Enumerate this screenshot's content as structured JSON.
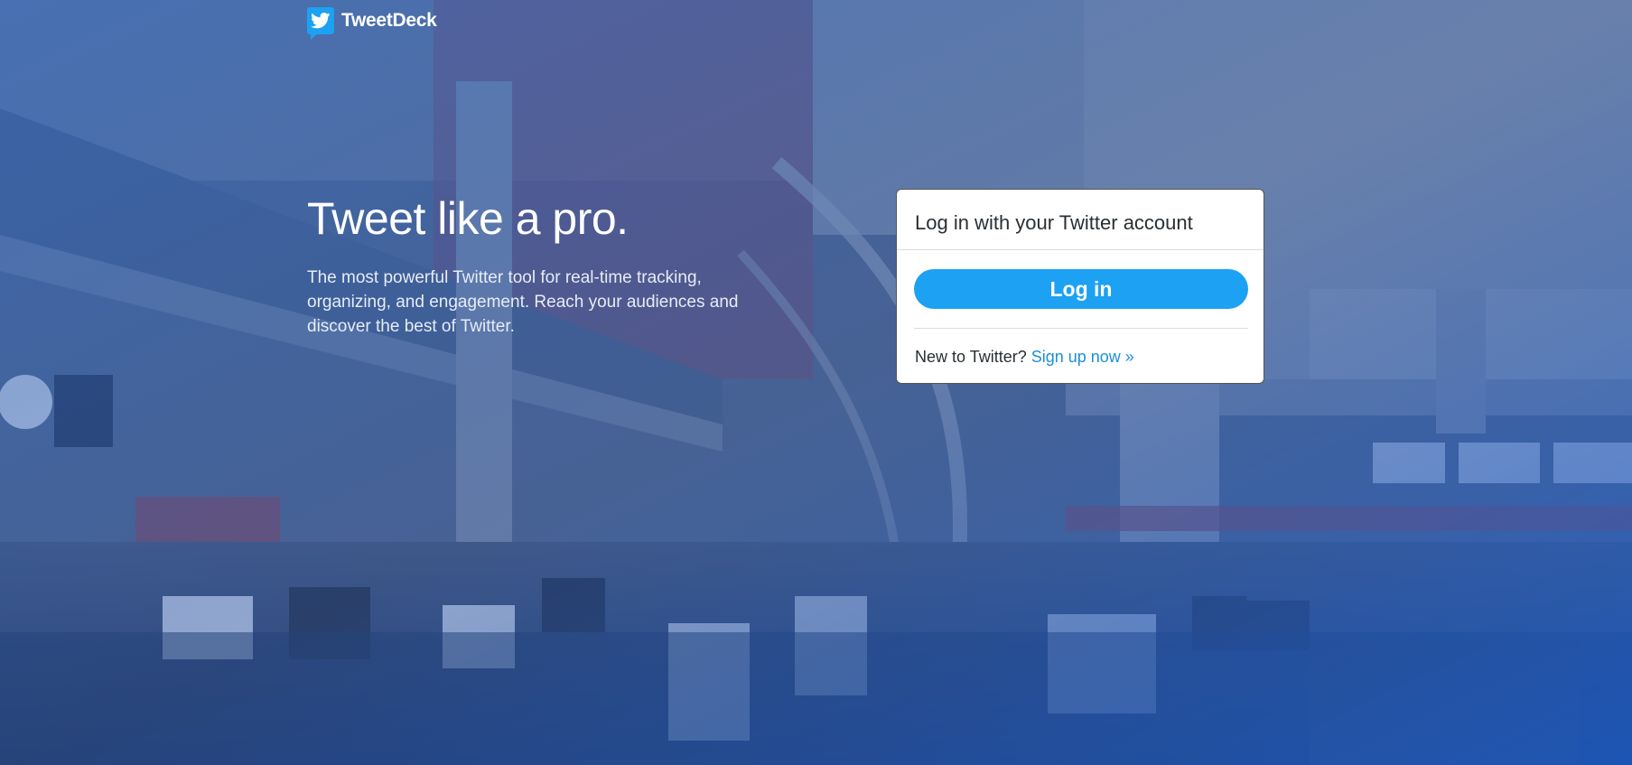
{
  "brand": {
    "name": "TweetDeck",
    "logo_icon": "twitter-bird-icon",
    "accent_color": "#1da1f2"
  },
  "hero": {
    "title": "Tweet like a pro.",
    "subtitle": "The most powerful Twitter tool for real-time tracking, organizing, and engagement. Reach your audiences and discover the best of Twitter."
  },
  "login_card": {
    "title": "Log in with your Twitter account",
    "login_button": "Log in",
    "signup_prompt": "New to Twitter?",
    "signup_link": "Sign up now »"
  },
  "background": {
    "image": "newsroom-office-photo",
    "overlay_color": "#1a5fc4"
  }
}
